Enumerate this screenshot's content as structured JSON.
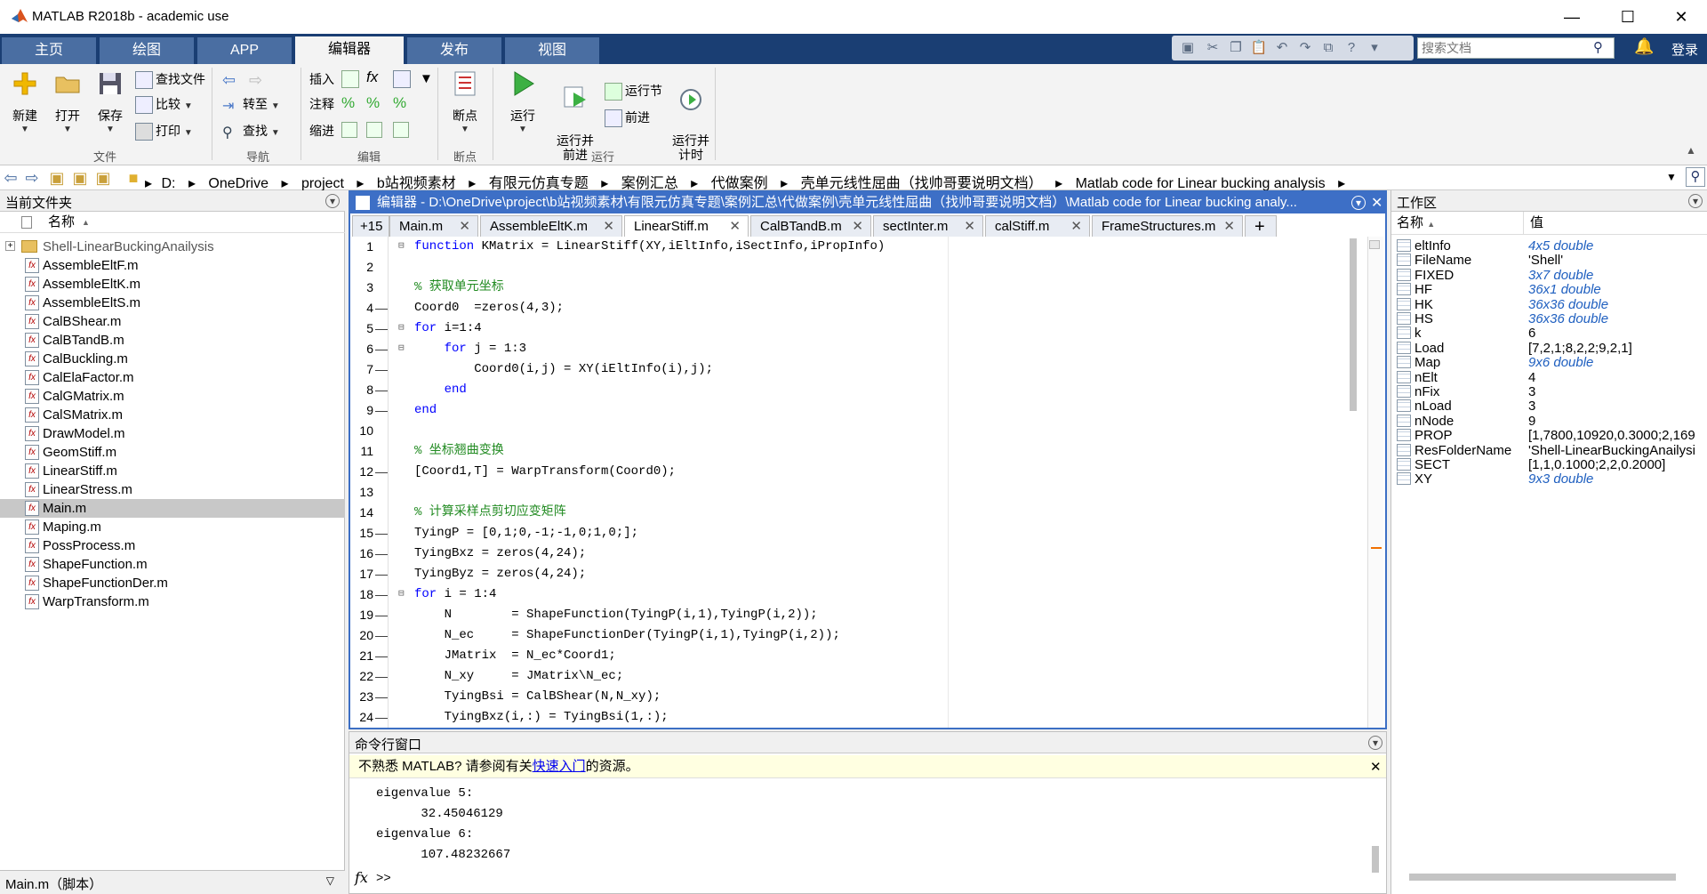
{
  "window": {
    "title": "MATLAB R2018b - academic use",
    "minimize": "—",
    "maximize": "☐",
    "close": "✕"
  },
  "ribbon_tabs": [
    "主页",
    "绘图",
    "APP",
    "编辑器",
    "发布",
    "视图"
  ],
  "search": {
    "placeholder": "搜索文档"
  },
  "login": "登录",
  "ribbon": {
    "file": {
      "new": "新建",
      "open": "打开",
      "save": "保存",
      "find_files": "查找文件",
      "compare": "比较",
      "print": "打印",
      "group": "文件"
    },
    "nav": {
      "goto": "转至",
      "find": "查找",
      "group": "导航"
    },
    "edit": {
      "insert": "插入",
      "comment": "注释",
      "indent": "缩进",
      "group": "编辑"
    },
    "breakpoints": {
      "label": "断点",
      "group": "断点"
    },
    "run": {
      "run": "运行",
      "run_advance": "运行并\n前进",
      "run_section": "运行节",
      "advance": "前进",
      "run_time": "运行并\n计时",
      "group": "运行"
    }
  },
  "path": [
    "D:",
    "OneDrive",
    "project",
    "b站视频素材",
    "有限元仿真专题",
    "案例汇总",
    "代做案例",
    "壳单元线性屈曲（找帅哥要说明文档）",
    "Matlab code for Linear bucking analysis"
  ],
  "left_panel": {
    "title": "当前文件夹",
    "col_name": "名称",
    "folder": "Shell-LinearBuckingAnailysis",
    "files": [
      "AssembleEltF.m",
      "AssembleEltK.m",
      "AssembleEltS.m",
      "CalBShear.m",
      "CalBTandB.m",
      "CalBuckling.m",
      "CalElaFactor.m",
      "CalGMatrix.m",
      "CalSMatrix.m",
      "DrawModel.m",
      "GeomStiff.m",
      "LinearStiff.m",
      "LinearStress.m",
      "Main.m",
      "Maping.m",
      "PossProcess.m",
      "ShapeFunction.m",
      "ShapeFunctionDer.m",
      "WarpTransform.m"
    ],
    "selected": "Main.m",
    "footer": "Main.m（脚本）"
  },
  "editor": {
    "title": "编辑器 - D:\\OneDrive\\project\\b站视频素材\\有限元仿真专题\\案例汇总\\代做案例\\壳单元线性屈曲（找帅哥要说明文档）\\Matlab code for Linear bucking analy...",
    "overflow_tabs": "+15",
    "tabs": [
      "Main.m",
      "AssembleEltK.m",
      "LinearStiff.m",
      "CalBTandB.m",
      "sectInter.m",
      "calStiff.m",
      "FrameStructures.m"
    ],
    "active_tab": "LinearStiff.m",
    "add_tab": "+",
    "lines": [
      {
        "n": "1",
        "m": "",
        "f": "⊟",
        "t": "function KMatrix = LinearStiff(XY,iEltInfo,iSectInfo,iPropInfo)",
        "k": "function"
      },
      {
        "n": "2",
        "m": "",
        "f": "",
        "t": ""
      },
      {
        "n": "3",
        "m": "",
        "f": "",
        "t": "% 获取单元坐标",
        "c": true
      },
      {
        "n": "4",
        "m": "—",
        "f": "",
        "t": "Coord0  =zeros(4,3);"
      },
      {
        "n": "5",
        "m": "—",
        "f": "⊟",
        "t": "for i=1:4",
        "k": "for"
      },
      {
        "n": "6",
        "m": "—",
        "f": "⊟",
        "t": "    for j = 1:3",
        "k": "for"
      },
      {
        "n": "7",
        "m": "—",
        "f": "",
        "t": "        Coord0(i,j) = XY(iEltInfo(i),j);"
      },
      {
        "n": "8",
        "m": "—",
        "f": "",
        "t": "    end",
        "k": "end"
      },
      {
        "n": "9",
        "m": "—",
        "f": "",
        "t": "end",
        "k": "end"
      },
      {
        "n": "10",
        "m": "",
        "f": "",
        "t": ""
      },
      {
        "n": "11",
        "m": "",
        "f": "",
        "t": "% 坐标翘曲变换",
        "c": true
      },
      {
        "n": "12",
        "m": "—",
        "f": "",
        "t": "[Coord1,T] = WarpTransform(Coord0);"
      },
      {
        "n": "13",
        "m": "",
        "f": "",
        "t": ""
      },
      {
        "n": "14",
        "m": "",
        "f": "",
        "t": "% 计算采样点剪切应变矩阵",
        "c": true
      },
      {
        "n": "15",
        "m": "—",
        "f": "",
        "t": "TyingP = [0,1;0,-1;-1,0;1,0;];"
      },
      {
        "n": "16",
        "m": "—",
        "f": "",
        "t": "TyingBxz = zeros(4,24);"
      },
      {
        "n": "17",
        "m": "—",
        "f": "",
        "t": "TyingByz = zeros(4,24);"
      },
      {
        "n": "18",
        "m": "—",
        "f": "⊟",
        "t": "for i = 1:4",
        "k": "for"
      },
      {
        "n": "19",
        "m": "—",
        "f": "",
        "t": "    N        = ShapeFunction(TyingP(i,1),TyingP(i,2));"
      },
      {
        "n": "20",
        "m": "—",
        "f": "",
        "t": "    N_ec     = ShapeFunctionDer(TyingP(i,1),TyingP(i,2));"
      },
      {
        "n": "21",
        "m": "—",
        "f": "",
        "t": "    JMatrix  = N_ec*Coord1;"
      },
      {
        "n": "22",
        "m": "—",
        "f": "",
        "t": "    N_xy     = JMatrix\\N_ec;"
      },
      {
        "n": "23",
        "m": "—",
        "f": "",
        "t": "    TyingBsi = CalBShear(N,N_xy);"
      },
      {
        "n": "24",
        "m": "—",
        "f": "",
        "t": "    TyingBxz(i,:) = TyingBsi(1,:);"
      }
    ]
  },
  "command_window": {
    "title": "命令行窗口",
    "hint_pre": "不熟悉 MATLAB? 请参阅有关",
    "hint_link": "快速入门",
    "hint_post": "的资源。",
    "output": [
      "eigenvalue 5:",
      "      32.45046129",
      "eigenvalue 6:",
      "      107.48232667"
    ],
    "prompt": ">>",
    "fx": "fx"
  },
  "workspace": {
    "title": "工作区",
    "col_name": "名称",
    "col_value": "值",
    "vars": [
      {
        "name": "eltInfo",
        "value": "4x5 double",
        "italic": true
      },
      {
        "name": "FileName",
        "value": "'Shell'",
        "italic": false
      },
      {
        "name": "FIXED",
        "value": "3x7 double",
        "italic": true
      },
      {
        "name": "HF",
        "value": "36x1 double",
        "italic": true
      },
      {
        "name": "HK",
        "value": "36x36 double",
        "italic": true
      },
      {
        "name": "HS",
        "value": "36x36 double",
        "italic": true
      },
      {
        "name": "k",
        "value": "6",
        "italic": false
      },
      {
        "name": "Load",
        "value": "[7,2,1;8,2,2;9,2,1]",
        "italic": false
      },
      {
        "name": "Map",
        "value": "9x6 double",
        "italic": true
      },
      {
        "name": "nElt",
        "value": "4",
        "italic": false
      },
      {
        "name": "nFix",
        "value": "3",
        "italic": false
      },
      {
        "name": "nLoad",
        "value": "3",
        "italic": false
      },
      {
        "name": "nNode",
        "value": "9",
        "italic": false
      },
      {
        "name": "PROP",
        "value": "[1,7800,10920,0.3000;2,169",
        "italic": false
      },
      {
        "name": "ResFolderName",
        "value": "'Shell-LinearBuckingAnailysi",
        "italic": false
      },
      {
        "name": "SECT",
        "value": "[1,1,0.1000;2,2,0.2000]",
        "italic": false
      },
      {
        "name": "XY",
        "value": "9x3 double",
        "italic": true
      }
    ]
  }
}
